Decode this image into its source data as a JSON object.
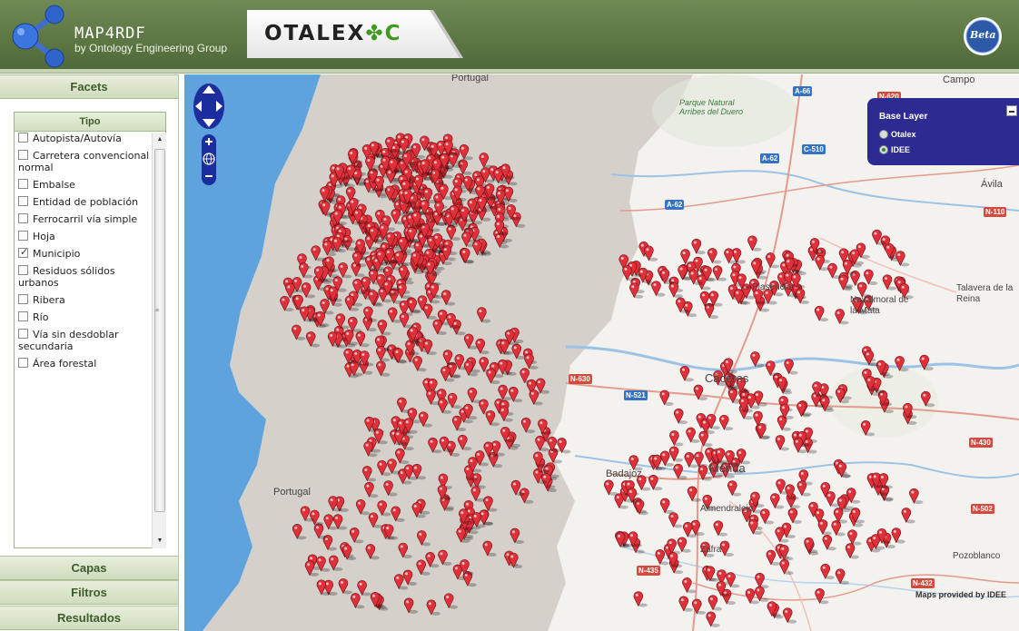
{
  "header": {
    "app_title": "MAP4RDF",
    "app_subtitle": "by Ontology Engineering Group",
    "partner_logo": {
      "part1": "OTALEX",
      "part2": "C"
    },
    "beta_label": "Beta",
    "colors": {
      "header_green": "#5b7642",
      "accent_green": "#3f9a1e"
    }
  },
  "sidebar": {
    "sections": [
      {
        "label": "Facets"
      },
      {
        "label": "Capas"
      },
      {
        "label": "Filtros"
      },
      {
        "label": "Resultados"
      }
    ],
    "tipo": {
      "title": "Tipo",
      "items": [
        {
          "label": "Autopista/Autovía",
          "checked": false
        },
        {
          "label": "Carretera convencional normal",
          "checked": false
        },
        {
          "label": "Embalse",
          "checked": false
        },
        {
          "label": "Entidad de población",
          "checked": false
        },
        {
          "label": "Ferrocarril vía simple",
          "checked": false
        },
        {
          "label": "Hoja",
          "checked": false
        },
        {
          "label": "Municipio",
          "checked": true
        },
        {
          "label": "Residuos sólidos urbanos",
          "checked": false
        },
        {
          "label": "Ribera",
          "checked": false
        },
        {
          "label": "Río",
          "checked": false
        },
        {
          "label": "Vía sin desdoblar secundaria",
          "checked": false
        },
        {
          "label": "Área forestal",
          "checked": false
        }
      ]
    }
  },
  "map": {
    "place_labels": [
      "Portugal",
      "Portugal",
      "Parque Natural Arribes del Duero",
      "Campo",
      "Ávila",
      "Talavera de la Reina",
      "Navalmoral de la Mata",
      "Plasencia",
      "Cáceres",
      "Mérida",
      "Badajoz",
      "Almendralejo",
      "Zafra",
      "Pozoblanco"
    ],
    "road_labels": [
      "A-66",
      "C-510",
      "A-62",
      "A-62",
      "N-620",
      "N-110",
      "N-430",
      "N-502",
      "N-435",
      "N-432",
      "N-630",
      "N-521"
    ],
    "layer_switcher": {
      "title": "Base Layer",
      "options": [
        {
          "label": "Otalex",
          "selected": false
        },
        {
          "label": "IDEE",
          "selected": true
        }
      ]
    },
    "attribution": "Maps provided by IDEE",
    "marker_color": "#e0313a",
    "colors": {
      "sea": "#5ea3de",
      "portugal_land": "#d6d0ca",
      "spain_land": "#f4f2ef",
      "control_blue": "#1c2d9f"
    }
  }
}
